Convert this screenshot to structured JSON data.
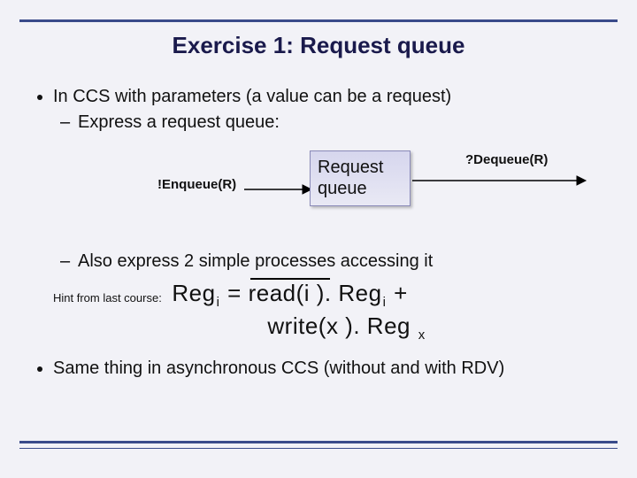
{
  "title": "Exercise 1: Request queue",
  "bullets": {
    "b1a": "In CCS with parameters (a value can be a request)",
    "b2a": "Express a request queue:",
    "b2b": "Also express 2 simple processes accessing it",
    "b1b": "Same thing in asynchronous CCS (without and with RDV)"
  },
  "diagram": {
    "enqueue": "!Enqueue(R)",
    "dequeue": "?Dequeue(R)",
    "box_line1": "Request",
    "box_line2": "queue"
  },
  "hint": {
    "label": "Hint from last course:",
    "formula": {
      "reg": "Reg",
      "i": "i",
      "eq": " = ",
      "read": "read(i ).",
      "plus": " + ",
      "write": "write(x ).",
      "x": "x",
      "space": " "
    }
  },
  "chart_data": {
    "type": "table",
    "title": "Request queue diagram",
    "nodes": [
      "Request queue"
    ],
    "edges": [
      {
        "label": "!Enqueue(R)",
        "from": "external-left",
        "to": "Request queue"
      },
      {
        "label": "?Dequeue(R)",
        "from": "Request queue",
        "to": "external-right"
      }
    ]
  }
}
